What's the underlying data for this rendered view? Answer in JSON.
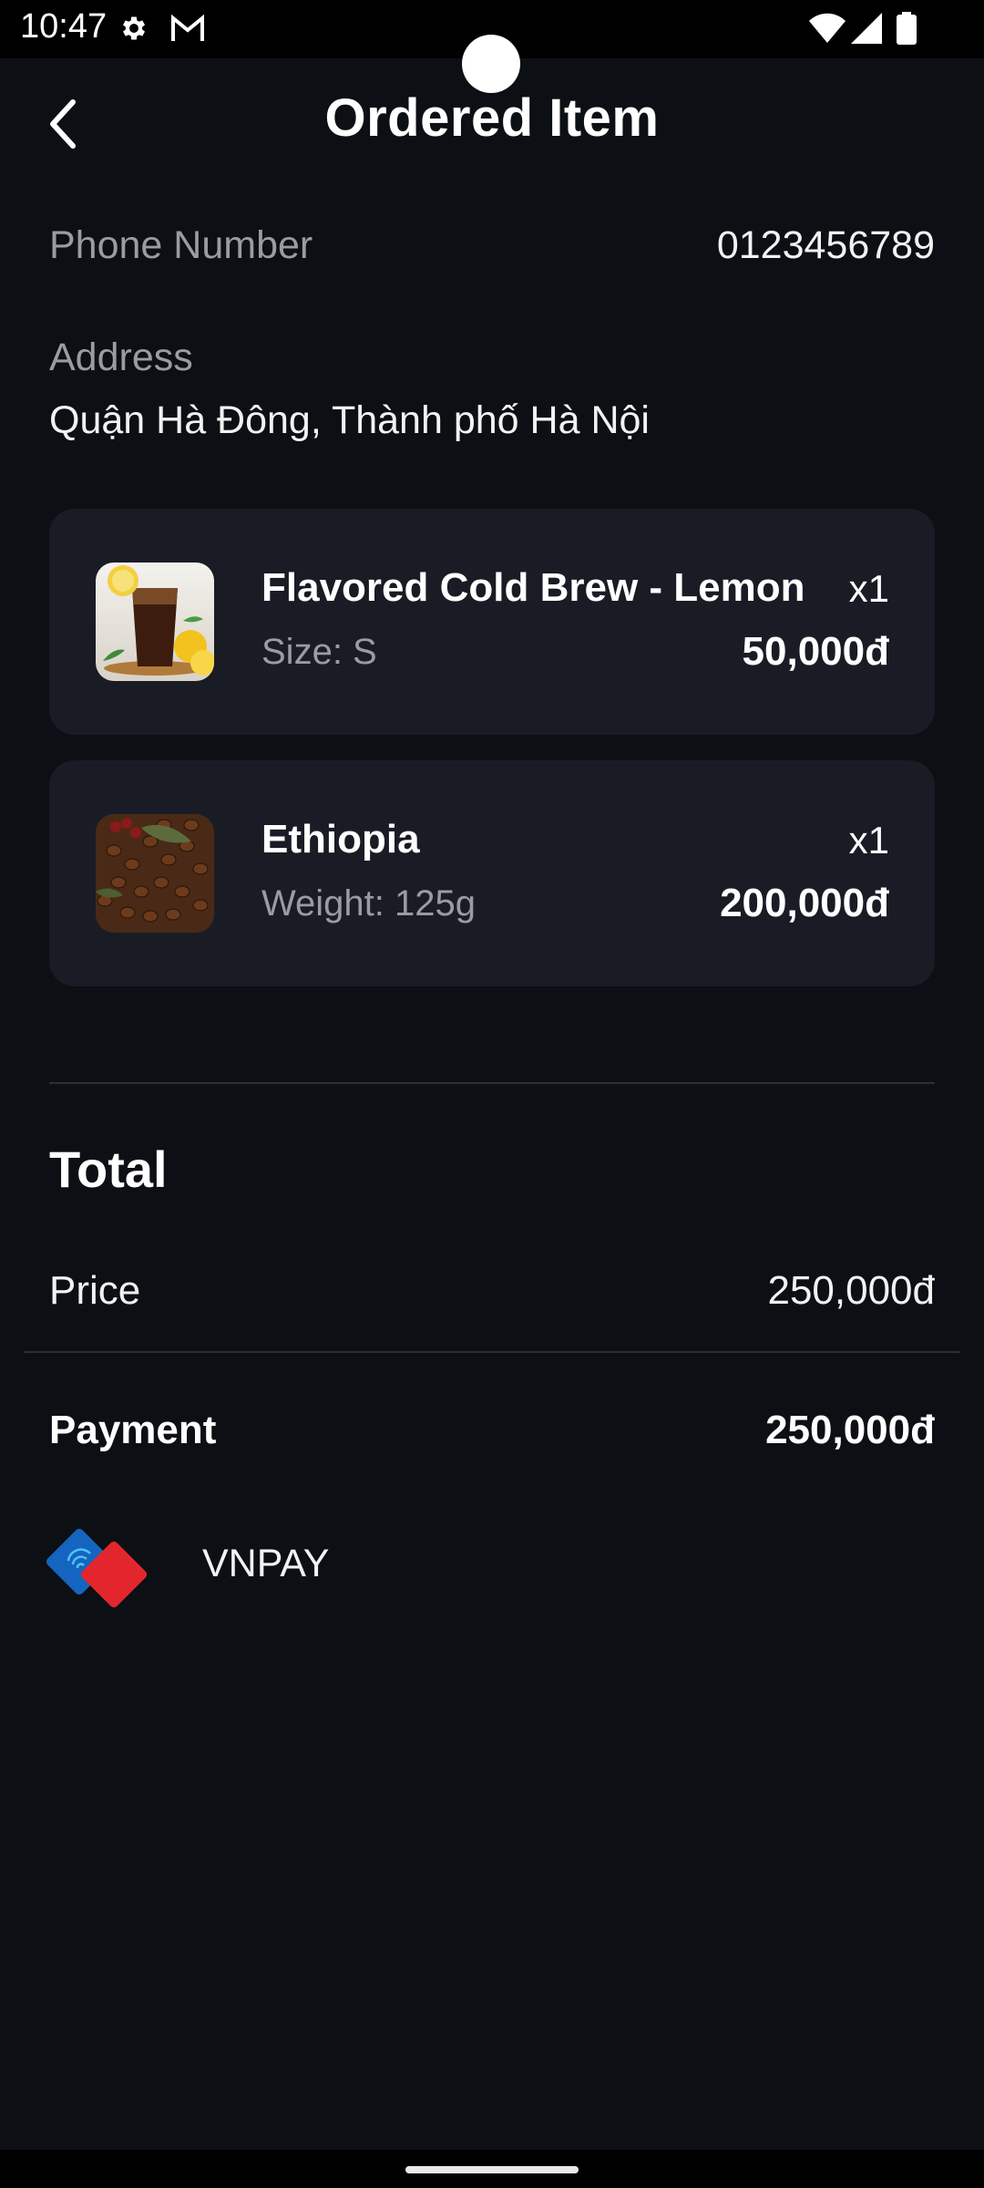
{
  "status_bar": {
    "time": "10:47",
    "icons": [
      "gear-icon",
      "gmail-icon",
      "wifi-icon",
      "signal-icon",
      "battery-icon"
    ]
  },
  "header": {
    "title": "Ordered Item",
    "back_icon": "chevron-left-icon"
  },
  "contact": {
    "phone_label": "Phone Number",
    "phone_value": "0123456789",
    "address_label": "Address",
    "address_value": "Quận Hà Đông, Thành phố Hà Nội"
  },
  "items": [
    {
      "name": "Flavored Cold Brew - Lemon",
      "detail": "Size: S",
      "quantity": "x1",
      "price": "50,000đ",
      "image": "iced-coffee-lemon-image"
    },
    {
      "name": "Ethiopia",
      "detail": "Weight: 125g",
      "quantity": "x1",
      "price": "200,000đ",
      "image": "coffee-beans-image"
    }
  ],
  "summary": {
    "total_title": "Total",
    "price_label": "Price",
    "price_value": "250,000đ",
    "payment_label": "Payment",
    "payment_value": "250,000đ"
  },
  "payment_method": {
    "name": "VNPAY",
    "logo": "vnpay-logo",
    "colors": {
      "blue": "#1565c0",
      "red": "#e3262d"
    }
  },
  "theme": {
    "background": "#0c0f14",
    "card": "#191c24",
    "muted_text": "#9a9ca2"
  }
}
